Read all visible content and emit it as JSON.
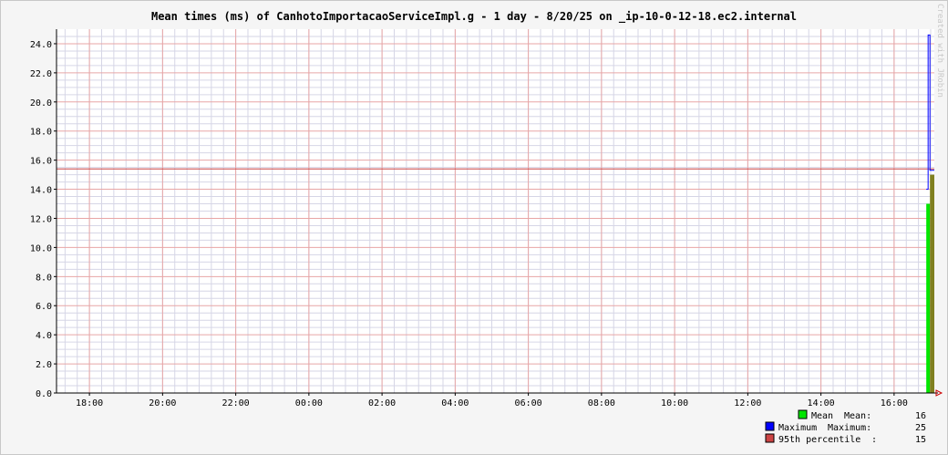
{
  "chart_data": {
    "type": "area",
    "title": "Mean times (ms) of CanhotoImportacaoServiceImpl.g - 1 day - 8/20/25 on _ip-10-0-12-18.ec2.internal",
    "xlabel": "",
    "ylabel": "",
    "x_ticks": [
      "18:00",
      "20:00",
      "22:00",
      "00:00",
      "02:00",
      "04:00",
      "06:00",
      "08:00",
      "10:00",
      "12:00",
      "14:00",
      "16:00"
    ],
    "y_ticks": [
      "0.0",
      "2.0",
      "4.0",
      "6.0",
      "8.0",
      "10.0",
      "12.0",
      "14.0",
      "16.0",
      "18.0",
      "20.0",
      "22.0",
      "24.0"
    ],
    "ylim": [
      0,
      25
    ],
    "xlim_hours": [
      17.1,
      41.1
    ],
    "grid": true,
    "watermark": "Created with JRobin",
    "series": [
      {
        "name": "Mean",
        "color": "#00e600",
        "points": [
          [
            40.88,
            13
          ],
          [
            40.98,
            15
          ]
        ]
      },
      {
        "name": "Maximum",
        "color": "#0000ff",
        "points": [
          [
            40.88,
            14
          ],
          [
            40.93,
            24.6
          ],
          [
            40.98,
            15.3
          ]
        ]
      },
      {
        "name": "95th percentile",
        "color": "#cc4444",
        "value": 15.4
      }
    ],
    "legend": [
      {
        "name": "Mean",
        "label": "Mean",
        "stat": "Mean:",
        "value": "16",
        "color": "#00e600"
      },
      {
        "name": "Maximum",
        "label": "Maximum",
        "stat": "Maximum:",
        "value": "25",
        "color": "#0000ff"
      },
      {
        "name": "95th percentile",
        "label": "95th percentile",
        "stat": ":",
        "value": "15",
        "color": "#cc4444"
      }
    ]
  }
}
